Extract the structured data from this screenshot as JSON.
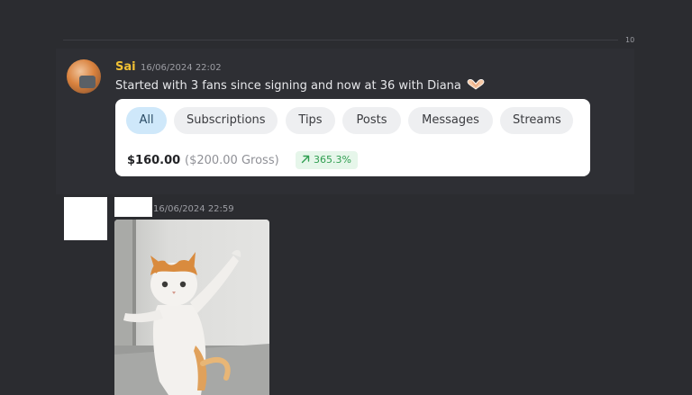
{
  "divider": {
    "label": "10"
  },
  "message1": {
    "author": "Sai",
    "author_color": "#f0c034",
    "timestamp": "16/06/2024 22:02",
    "text": "Started with 3 fans since signing and now at 36 with Diana",
    "emoji": "heart-hands-icon"
  },
  "earnings_card": {
    "tabs": [
      {
        "label": "All",
        "active": true
      },
      {
        "label": "Subscriptions",
        "active": false
      },
      {
        "label": "Tips",
        "active": false
      },
      {
        "label": "Posts",
        "active": false
      },
      {
        "label": "Messages",
        "active": false
      },
      {
        "label": "Streams",
        "active": false
      }
    ],
    "net_amount": "$160.00",
    "gross_amount": "($200.00 Gross)",
    "growth": "365.3%",
    "growth_color": "#2f9e50"
  },
  "message2": {
    "timestamp": "16/06/2024 22:59",
    "image": "dancing-cat-image"
  }
}
